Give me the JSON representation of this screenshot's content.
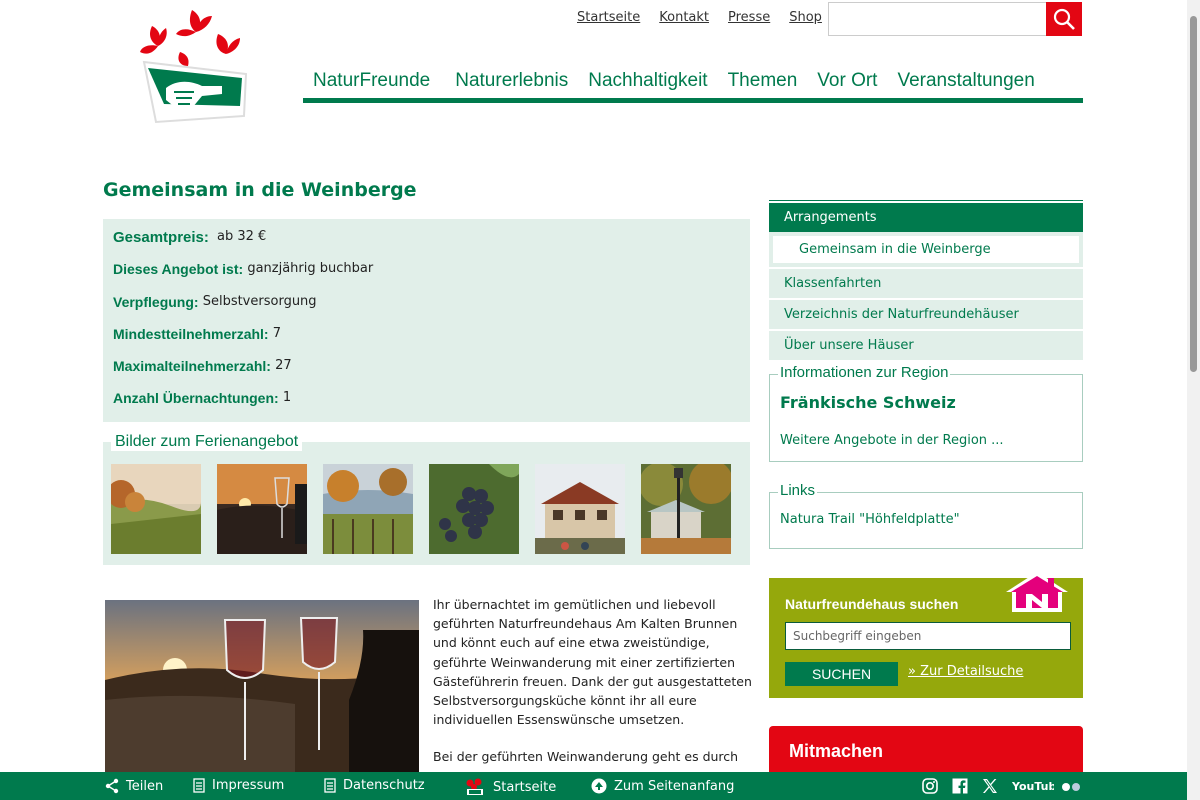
{
  "topnav": [
    "Startseite",
    "Kontakt",
    "Presse",
    "Shop"
  ],
  "mainnav": [
    "NaturFreunde",
    "Naturerlebnis",
    "Nachhaltigkeit",
    "Themen",
    "Vor Ort",
    "Veranstaltungen"
  ],
  "page_title": "Gemeinsam in die Weinberge",
  "facts": [
    {
      "label": "Gesamtpreis:",
      "value": "ab 32 €"
    },
    {
      "label": "Dieses Angebot ist:",
      "value": "ganzjährig buchbar"
    },
    {
      "label": "Verpflegung:",
      "value": "Selbstversorgung"
    },
    {
      "label": "Mindestteilnehmerzahl:",
      "value": "7"
    },
    {
      "label": "Maximalteilnehmerzahl:",
      "value": "27"
    },
    {
      "label": "Anzahl Übernachtungen:",
      "value": "1"
    }
  ],
  "gallery_title": "Bilder zum Ferienangebot",
  "body_text": [
    "Ihr übernachtet im gemütlichen und liebevoll geführten Naturfreundehaus Am Kalten Brunnen und könnt euch auf eine etwa zweistündige, geführte Weinwanderung mit einer zertifizierten Gästeführerin freuen. Dank der gut ausgestatteten Selbstversorgungsküche könnt ihr all eure individuellen Essenswünsche umsetzen.",
    "Bei der geführten Weinwanderung geht es durch"
  ],
  "sidenav": {
    "active": "Arrangements",
    "sub": "Gemeinsam in die Weinberge",
    "items": [
      "Klassenfahrten",
      "Verzeichnis der Naturfreundehäuser",
      "Über unsere Häuser"
    ]
  },
  "region": {
    "legend": "Informationen zur Region",
    "name": "Fränkische Schweiz",
    "link": "Weitere Angebote in der Region ..."
  },
  "links": {
    "legend": "Links",
    "item": "Natura Trail \"Höhfeldplatte\""
  },
  "house_search": {
    "title": "Naturfreundehaus suchen",
    "placeholder": "Suchbegriff eingeben",
    "button": "SUCHEN",
    "detail_link": "» Zur Detailsuche"
  },
  "mitmachen": "Mitmachen",
  "bottombar": [
    "Teilen",
    "Impressum",
    "Datenschutz",
    "Startseite",
    "Zum Seitenanfang"
  ],
  "social": {
    "youtube": "YouTube"
  },
  "colors": {
    "green": "#007a4d",
    "lightgreen": "#e1efe9",
    "red": "#e30613",
    "olive": "#95a80c"
  }
}
